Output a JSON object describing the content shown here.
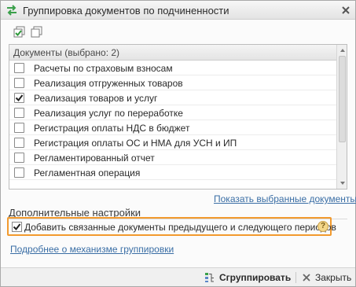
{
  "window": {
    "title": "Группировка документов по подчиненности",
    "accent_color": "#f29a2e",
    "link_color": "#3a6ea5"
  },
  "toolbar": {
    "check_all_icon": "check-all-icon",
    "uncheck_all_icon": "uncheck-all-icon"
  },
  "documents": {
    "header": "Документы (выбрано: 2)",
    "items": [
      {
        "label": "Расчеты по страховым взносам",
        "checked": false
      },
      {
        "label": "Реализация отгруженных товаров",
        "checked": false
      },
      {
        "label": "Реализация товаров и услуг",
        "checked": true
      },
      {
        "label": "Реализация услуг по переработке",
        "checked": false
      },
      {
        "label": "Регистрация оплаты НДС в бюджет",
        "checked": false
      },
      {
        "label": "Регистрация оплаты ОС и НМА для УСН и ИП",
        "checked": false
      },
      {
        "label": "Регламентированный отчет",
        "checked": false
      },
      {
        "label": "Регламентная операция",
        "checked": false
      }
    ]
  },
  "show_selected_link": "Показать выбранные документы",
  "extra": {
    "section_title": "Дополнительные настройки",
    "option_label": "Добавить связанные документы предыдущего и следующего периодов",
    "option_checked": true,
    "help_label": "?"
  },
  "more_link": "Подробнее о механизме группировки",
  "footer": {
    "group_button": "Сгруппировать",
    "close_button": "Закрыть"
  }
}
